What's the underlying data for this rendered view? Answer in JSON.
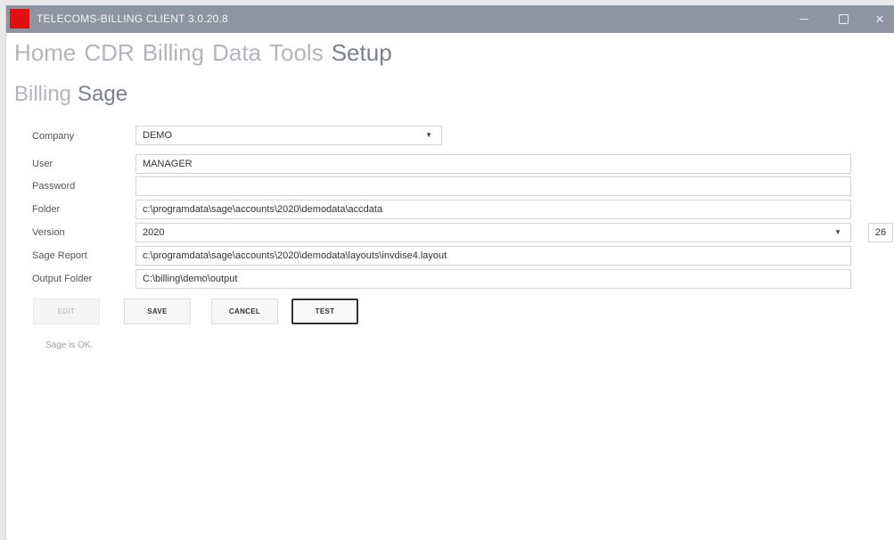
{
  "window": {
    "title": "TELECOMS-BILLING CLIENT 3.0.20.8",
    "minimize_icon": "minimize-icon",
    "maximize_icon": "maximize-icon",
    "close_icon": "close-icon",
    "close_glyph": "✕",
    "titlebar_color": "#8d95a3",
    "app_icon_color": "#e01010"
  },
  "main_nav": {
    "items": [
      "Home",
      "CDR",
      "Billing",
      "Data",
      "Tools",
      "Setup"
    ],
    "active": "Setup"
  },
  "sub_nav": {
    "items": [
      "Billing",
      "Sage"
    ],
    "active": "Sage"
  },
  "form": {
    "company": {
      "label": "Company",
      "value": "DEMO"
    },
    "user": {
      "label": "User",
      "value": "MANAGER"
    },
    "password": {
      "label": "Password",
      "value": ""
    },
    "folder": {
      "label": "Folder",
      "value": "c:\\programdata\\sage\\accounts\\2020\\demodata\\accdata"
    },
    "version": {
      "label": "Version",
      "value": "2020",
      "number": "26"
    },
    "sage_report": {
      "label": "Sage Report",
      "value": "c:\\programdata\\sage\\accounts\\2020\\demodata\\layouts\\invdise4.layout"
    },
    "output_folder": {
      "label": "Output Folder",
      "value": "C:\\billing\\demo\\output"
    }
  },
  "buttons": {
    "edit": "EDIT",
    "save": "SAVE",
    "cancel": "CANCEL",
    "test": "TEST"
  },
  "status": "Sage is OK.",
  "dropdown_glyph": "▼"
}
